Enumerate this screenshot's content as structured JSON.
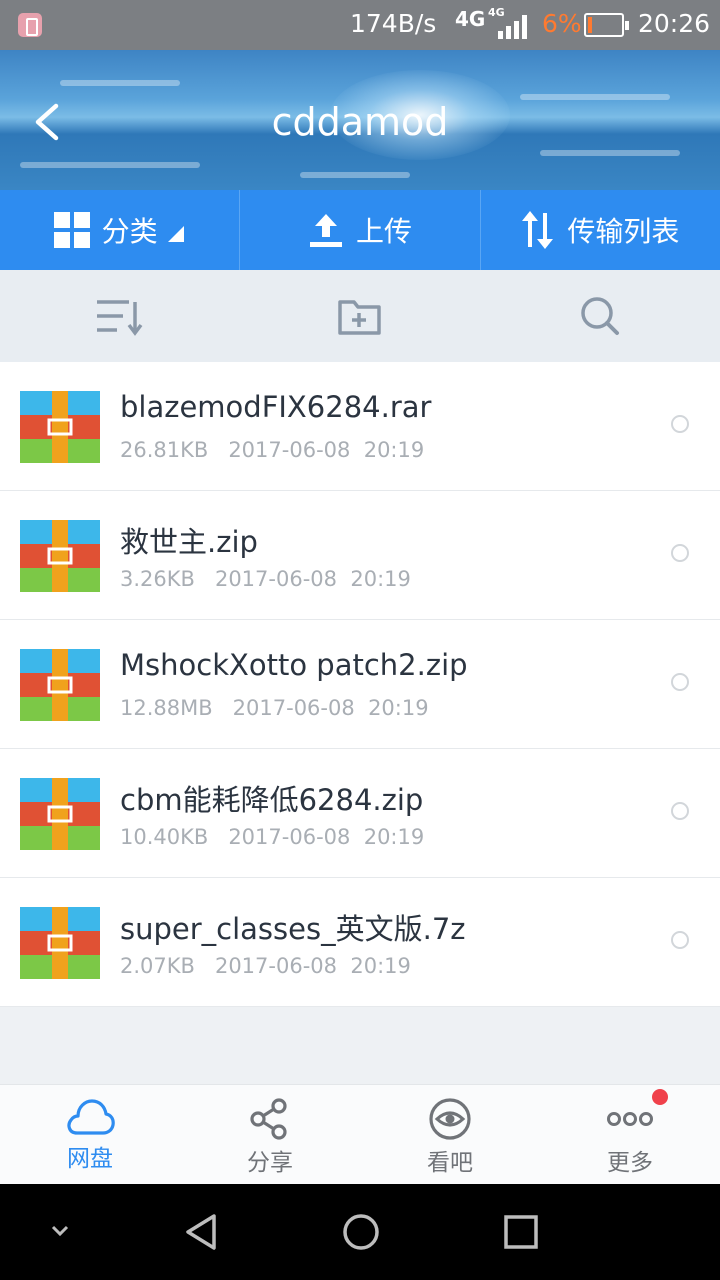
{
  "status_bar": {
    "net_speed": "174B/s",
    "network_1": "4G",
    "network_2": "4G",
    "battery_percent": "6%",
    "time": "20:26"
  },
  "header": {
    "title": "cddamod",
    "back_icon": "chevron-left-icon"
  },
  "tabs": [
    {
      "label": "分类",
      "icon": "grid-icon"
    },
    {
      "label": "上传",
      "icon": "upload-icon"
    },
    {
      "label": "传输列表",
      "icon": "transfer-icon"
    }
  ],
  "toolbar": {
    "sort_icon": "sort-icon",
    "new_folder_icon": "new-folder-icon",
    "search_icon": "search-icon"
  },
  "files": [
    {
      "name": "blazemodFIX6284.rar",
      "meta": "26.81KB   2017-06-08  20:19"
    },
    {
      "name": "救世主.zip",
      "meta": "3.26KB   2017-06-08  20:19"
    },
    {
      "name": "MshockXotto patch2.zip",
      "meta": "12.88MB   2017-06-08  20:19"
    },
    {
      "name": "cbm能耗降低6284.zip",
      "meta": "10.40KB   2017-06-08  20:19"
    },
    {
      "name": "super_classes_英文版.7z",
      "meta": "2.07KB   2017-06-08  20:19"
    }
  ],
  "bottom_nav": [
    {
      "label": "网盘",
      "icon": "cloud-icon"
    },
    {
      "label": "分享",
      "icon": "share-icon"
    },
    {
      "label": "看吧",
      "icon": "eye-icon"
    },
    {
      "label": "更多",
      "icon": "more-icon"
    }
  ],
  "colors": {
    "accent": "#2e8cf0",
    "notification": "#f0414b",
    "battery_low": "#ff7a30"
  }
}
